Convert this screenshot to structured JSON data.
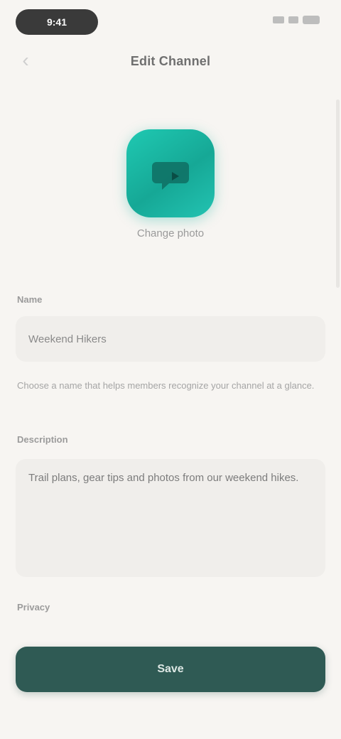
{
  "status_bar": {
    "time": "9:41"
  },
  "nav": {
    "back_glyph": "‹",
    "title": "Edit Channel"
  },
  "avatar": {
    "icon": "chat-bubble-icon",
    "change_label": "Change photo",
    "color": "#1fc9b2"
  },
  "name": {
    "label": "Name",
    "value": "Weekend Hikers",
    "helper": "Choose a name that helps members recognize your channel at a glance."
  },
  "description": {
    "label": "Description",
    "value": "Trail plans, gear tips and photos from our weekend hikes."
  },
  "privacy": {
    "label": "Privacy"
  },
  "save": {
    "label": "Save",
    "color": "#2f5a54"
  }
}
